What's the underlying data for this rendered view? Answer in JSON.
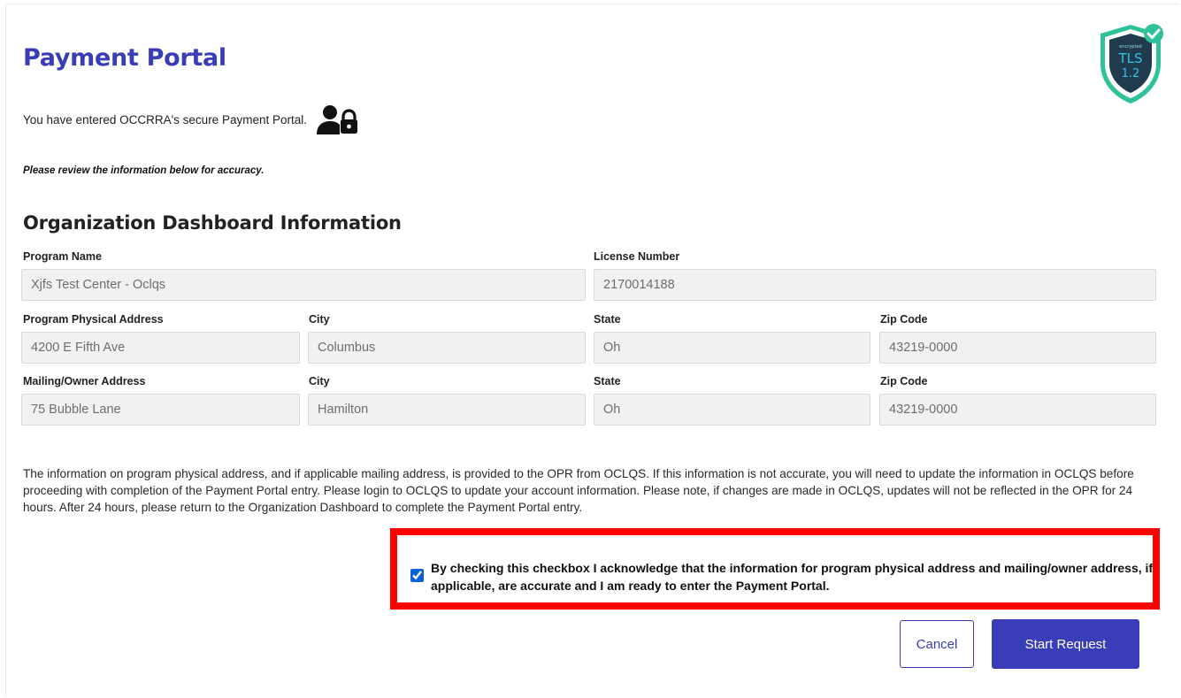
{
  "header": {
    "title": "Payment Portal"
  },
  "badge": {
    "small_text": "encrypted",
    "main_text": "TLS",
    "version": "1.2"
  },
  "intro": {
    "text": "You have entered OCCRRA's secure Payment Portal.",
    "icon": "user-lock-icon",
    "review_note": "Please review the information below for accuracy."
  },
  "section": {
    "title": "Organization Dashboard Information",
    "program_name_label": "Program Name",
    "program_name_value": "Xjfs Test Center - Oclqs",
    "license_number_label": "License Number",
    "license_number_value": "2170014188",
    "physical": {
      "address_label": "Program Physical Address",
      "address_value": "4200 E Fifth Ave",
      "city_label": "City",
      "city_value": "Columbus",
      "state_label": "State",
      "state_value": "Oh",
      "zip_label": "Zip Code",
      "zip_value": "43219-0000"
    },
    "mailing": {
      "address_label": "Mailing/Owner Address",
      "address_value": "75 Bubble Lane",
      "city_label": "City",
      "city_value": "Hamilton",
      "state_label": "State",
      "state_value": "Oh",
      "zip_label": "Zip Code",
      "zip_value": "43219-0000"
    }
  },
  "notice": "The information on program physical address, and if applicable mailing address, is provided to the OPR from OCLQS. If this information is not accurate, you will need to update the information in OCLQS before proceeding with completion of the Payment Portal entry. Please login to OCLQS to update your account information. Please note, if changes are made in OCLQS, updates will not be reflected in the OPR for 24 hours. After 24 hours, please return to the Organization Dashboard to complete the Payment Portal entry.",
  "acknowledgement": {
    "checked": true,
    "text": "By checking this checkbox I acknowledge that the information for program physical address and mailing/owner address, if applicable, are accurate and I am ready to enter the Payment Portal.",
    "highlight_color": "#ff0000"
  },
  "actions": {
    "cancel_label": "Cancel",
    "start_label": "Start Request"
  },
  "colors": {
    "brand": "#3a3db8",
    "checkbox": "#0a63d6"
  }
}
